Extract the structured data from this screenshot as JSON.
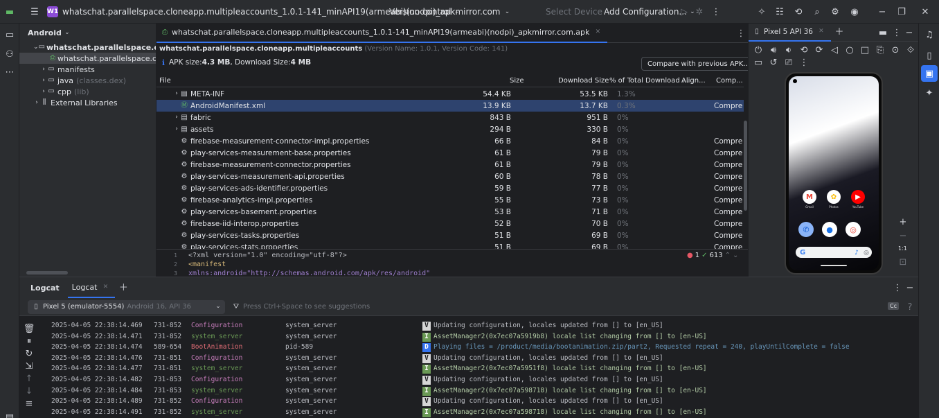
{
  "titlebar": {
    "project_badge": "W1",
    "project_path": "whatschat.parallelspace.cloneapp.multipleaccounts_1.0.1-141_minAPI19(armeabi)(nodpi)_apkmirror.com",
    "version_control": "Version control",
    "select_device": "Select Device",
    "add_configuration": "Add Configuration..."
  },
  "project": {
    "view_label": "Android",
    "items": [
      {
        "label": "whatschat.parallelspace.cloneapp.",
        "extra": ""
      },
      {
        "label": "whatschat.parallelspace.clonea",
        "extra": ""
      },
      {
        "label": "manifests",
        "extra": ""
      },
      {
        "label": "java",
        "extra": "(classes.dex)"
      },
      {
        "label": "cpp",
        "extra": "(lib)"
      },
      {
        "label": "External Libraries",
        "extra": ""
      }
    ]
  },
  "apk": {
    "tab_label": "whatschat.parallelspace.cloneapp.multipleaccounts_1.0.1-141_minAPI19(armeabi)(nodpi)_apkmirror.com.apk",
    "package_name": "whatschat.parallelspace.cloneapp.multipleaccounts",
    "version_info": "(Version Name: 1.0.1, Version Code: 141)",
    "size_prefix": "APK size: ",
    "apk_size": "4.3 MB",
    "dl_prefix": ", Download Size: ",
    "download_size": "4 MB",
    "compare_button": "Compare with previous APK...",
    "columns": {
      "file": "File",
      "size": "Size",
      "download": "Download Size",
      "pct": "% of Total Download ...",
      "align": "Align...",
      "comp": "Comp..."
    },
    "rows": [
      {
        "name": "META-INF",
        "type": "folder",
        "size": "54.4 KB",
        "dl": "53.5 KB",
        "pct": "1.3%",
        "comp": ""
      },
      {
        "name": "AndroidManifest.xml",
        "type": "manifest",
        "size": "13.9 KB",
        "dl": "13.7 KB",
        "pct": "0.3%",
        "comp": "Compre"
      },
      {
        "name": "fabric",
        "type": "folder",
        "size": "843 B",
        "dl": "951 B",
        "pct": "0%",
        "comp": ""
      },
      {
        "name": "assets",
        "type": "folder",
        "size": "294 B",
        "dl": "330 B",
        "pct": "0%",
        "comp": ""
      },
      {
        "name": "firebase-measurement-connector-impl.properties",
        "type": "file",
        "size": "66 B",
        "dl": "84 B",
        "pct": "0%",
        "comp": "Compre"
      },
      {
        "name": "play-services-measurement-base.properties",
        "type": "file",
        "size": "61 B",
        "dl": "79 B",
        "pct": "0%",
        "comp": "Compre"
      },
      {
        "name": "firebase-measurement-connector.properties",
        "type": "file",
        "size": "61 B",
        "dl": "79 B",
        "pct": "0%",
        "comp": "Compre"
      },
      {
        "name": "play-services-measurement-api.properties",
        "type": "file",
        "size": "60 B",
        "dl": "78 B",
        "pct": "0%",
        "comp": "Compre"
      },
      {
        "name": "play-services-ads-identifier.properties",
        "type": "file",
        "size": "59 B",
        "dl": "77 B",
        "pct": "0%",
        "comp": "Compre"
      },
      {
        "name": "firebase-analytics-impl.properties",
        "type": "file",
        "size": "55 B",
        "dl": "73 B",
        "pct": "0%",
        "comp": "Compre"
      },
      {
        "name": "play-services-basement.properties",
        "type": "file",
        "size": "53 B",
        "dl": "71 B",
        "pct": "0%",
        "comp": "Compre"
      },
      {
        "name": "firebase-iid-interop.properties",
        "type": "file",
        "size": "52 B",
        "dl": "70 B",
        "pct": "0%",
        "comp": "Compre"
      },
      {
        "name": "play-services-tasks.properties",
        "type": "file",
        "size": "51 B",
        "dl": "69 B",
        "pct": "0%",
        "comp": "Compre"
      },
      {
        "name": "play-services-stats.properties",
        "type": "file",
        "size": "51 B",
        "dl": "69 B",
        "pct": "0%",
        "comp": "Compre"
      }
    ],
    "code": {
      "lines": [
        {
          "num": "1",
          "text": "<?xml version=\"1.0\" encoding=\"utf-8\"?>"
        },
        {
          "num": "2",
          "text": "<manifest"
        },
        {
          "num": "3",
          "text": "    xmlns:android=\"http://schemas.android.com/apk/res/android\""
        }
      ],
      "errors": "1",
      "warnings": "613"
    }
  },
  "emulator": {
    "tab_label": "Pixel 5 API 36",
    "zoom_label": "1:1",
    "apps": [
      {
        "label": "Gmail",
        "letter": "M",
        "color": "#ffffff",
        "fg": "#ea4335"
      },
      {
        "label": "Photos",
        "letter": "✿",
        "color": "#ffffff",
        "fg": "#fbbc05"
      },
      {
        "label": "YouTube",
        "letter": "▶",
        "color": "#ff0000",
        "fg": "#ffffff"
      }
    ],
    "dock": [
      {
        "letter": "✆",
        "color": "#8ab4f8",
        "fg": "#0b57d0"
      },
      {
        "letter": "●",
        "color": "#ffffff",
        "fg": "#1a73e8"
      },
      {
        "letter": "◎",
        "color": "#ffffff",
        "fg": "#ea4335"
      }
    ]
  },
  "logcat": {
    "tab_main": "Logcat",
    "tab_second": "Logcat",
    "device": "Pixel 5 (emulator-5554)",
    "device_meta": "Android 16, API 36",
    "filter_placeholder": "Press Ctrl+Space to see suggestions",
    "lines": [
      {
        "time": "2025-04-05 22:38:14.469",
        "pid": "731-852",
        "tag": "Configuration",
        "pkg": "system_server",
        "level": "V",
        "msg": "Updating configuration, locales updated from [] to [en_US]"
      },
      {
        "time": "2025-04-05 22:38:14.471",
        "pid": "731-852",
        "tag": "system_server",
        "pkg": "system_server",
        "level": "I",
        "msg": "AssetManager2(0x7ec07a5919b8) locale list changing from [] to [en-US]"
      },
      {
        "time": "2025-04-05 22:38:14.474",
        "pid": "589-654",
        "tag": "BootAnimation",
        "pkg": "pid-589",
        "level": "D",
        "msg": "Playing files = /product/media/bootanimation.zip/part2, Requested repeat = 240, playUntilComplete = false"
      },
      {
        "time": "2025-04-05 22:38:14.476",
        "pid": "731-851",
        "tag": "Configuration",
        "pkg": "system_server",
        "level": "V",
        "msg": "Updating configuration, locales updated from [] to [en_US]"
      },
      {
        "time": "2025-04-05 22:38:14.477",
        "pid": "731-851",
        "tag": "system_server",
        "pkg": "system_server",
        "level": "I",
        "msg": "AssetManager2(0x7ec07a5951f8) locale list changing from [] to [en-US]"
      },
      {
        "time": "2025-04-05 22:38:14.482",
        "pid": "731-853",
        "tag": "Configuration",
        "pkg": "system_server",
        "level": "V",
        "msg": "Updating configuration, locales updated from [] to [en_US]"
      },
      {
        "time": "2025-04-05 22:38:14.484",
        "pid": "731-853",
        "tag": "system_server",
        "pkg": "system_server",
        "level": "I",
        "msg": "AssetManager2(0x7ec07a598718) locale list changing from [] to [en-US]"
      },
      {
        "time": "2025-04-05 22:38:14.489",
        "pid": "731-852",
        "tag": "Configuration",
        "pkg": "system_server",
        "level": "V",
        "msg": "Updating configuration, locales updated from [] to [en_US]"
      },
      {
        "time": "2025-04-05 22:38:14.491",
        "pid": "731-852",
        "tag": "system_server",
        "pkg": "system_server",
        "level": "I",
        "msg": "AssetManager2(0x7ec07a598718) locale list changing from [] to [en-US]"
      }
    ]
  },
  "colors": {
    "accent": "#3574f0",
    "tag_configuration": "#c77dbb",
    "tag_system_server": "#6a9955",
    "tag_boot": "#e06c75",
    "msg_info": "#b5cea8",
    "msg_debug": "#6897bb"
  }
}
